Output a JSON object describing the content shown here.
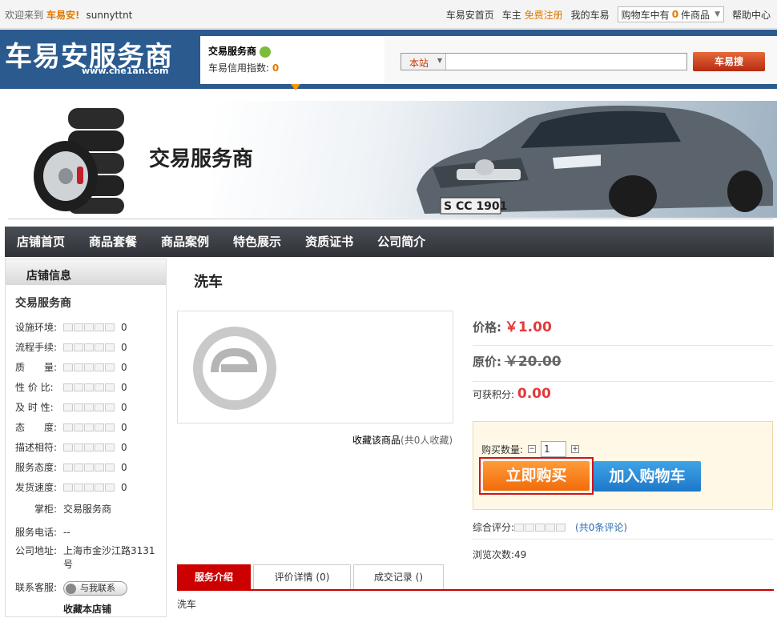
{
  "topbar": {
    "welcome": "欢迎来到",
    "brand": "车易安!",
    "username": "sunnyttnt",
    "links": {
      "home": "车易安首页",
      "owner": "车主",
      "register": "免费注册",
      "my": "我的车易",
      "help": "帮助中心"
    },
    "cart": {
      "prefix": "购物车中有",
      "count": "0",
      "suffix": "件商品"
    }
  },
  "header": {
    "logo": "车易安服务商",
    "logo_url": "www.che1an.com",
    "credit_name": "交易服务商",
    "credit_label": "车易信用指数:",
    "credit_value": "0",
    "search_scope": "本站",
    "search_button": "车易搜",
    "search_value": ""
  },
  "banner": {
    "title": "交易服务商"
  },
  "nav": [
    "店铺首页",
    "商品套餐",
    "商品案例",
    "特色展示",
    "资质证书",
    "公司简介"
  ],
  "sidebar": {
    "title": "店铺信息",
    "shop_name": "交易服务商",
    "ratings": [
      {
        "label": "设施环境:",
        "value": "0"
      },
      {
        "label": "流程手续:",
        "value": "0"
      },
      {
        "label": "质　　量:",
        "value": "0"
      },
      {
        "label": "性 价 比:",
        "value": "0"
      },
      {
        "label": "及 时 性:",
        "value": "0"
      },
      {
        "label": "态　　度:",
        "value": "0"
      },
      {
        "label": "描述相符:",
        "value": "0"
      },
      {
        "label": "服务态度:",
        "value": "0"
      },
      {
        "label": "发货速度:",
        "value": "0"
      }
    ],
    "keeper_label": "掌柜:",
    "keeper": "交易服务商",
    "phone_label": "服务电话:",
    "phone": "--",
    "address_label": "公司地址:",
    "address": "上海市金沙江路3131号",
    "service_label": "联系客服:",
    "contact_button": "与我联系",
    "favorite_shop": "收藏本店铺"
  },
  "product": {
    "title": "洗车",
    "favorite": "收藏该商品",
    "favorite_count": "(共0人收藏)",
    "price_label": "价格:",
    "price": "￥1.00",
    "orig_label": "原价:",
    "orig_price": "￥20.00",
    "points_label": "可获积分:",
    "points": "0.00",
    "qty_label": "购买数量:",
    "qty": "1",
    "buy_now": "立即购买",
    "add_cart": "加入购物车",
    "score_label": "综合评分:",
    "score_link": "(共0条评论)",
    "views": "浏览次数:49"
  },
  "tabs": [
    "服务介绍",
    "评价详情 (0)",
    "成交记录 ()"
  ],
  "tab_content": "洗车",
  "colors": {
    "header_bg": "#2a5a8e",
    "price_red": "#e4393c",
    "buy_orange": "#f26b0a",
    "cart_blue": "#1d78c8",
    "tab_red": "#cc0000"
  }
}
